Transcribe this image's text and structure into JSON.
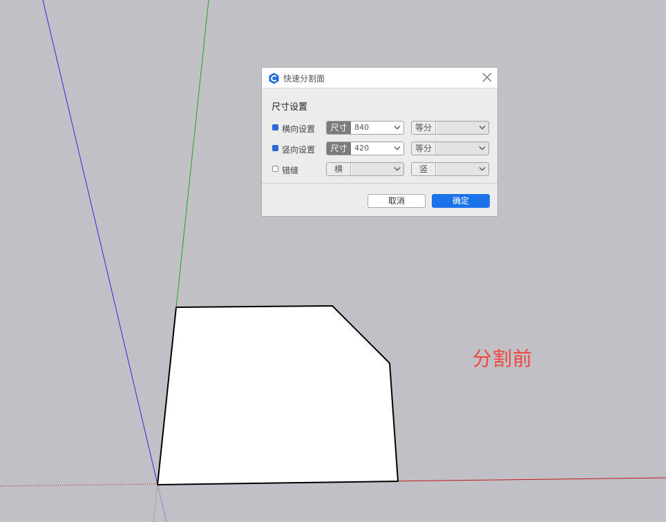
{
  "canvas": {
    "label": "分割前",
    "background": "#c0c0c6",
    "label_color": "#f0463c"
  },
  "dialog": {
    "title": "快速分割面",
    "app_icon": "app-logo-icon",
    "close_icon": "close-icon",
    "section_title": "尺寸设置",
    "rows": [
      {
        "label": "横向设置",
        "checked": true,
        "mode_tag": "尺寸",
        "value": "840",
        "second_tag": "等分",
        "second_value": ""
      },
      {
        "label": "竖向设置",
        "checked": true,
        "mode_tag": "尺寸",
        "value": "420",
        "second_tag": "等分",
        "second_value": ""
      },
      {
        "label": "错缝",
        "checked": false,
        "mode_tag": "横",
        "value": "",
        "second_tag": "竖",
        "second_value": ""
      }
    ],
    "cancel_label": "取消",
    "ok_label": "确定",
    "accent_color": "#1a73e8",
    "checkbox_color": "#2d69d9"
  }
}
